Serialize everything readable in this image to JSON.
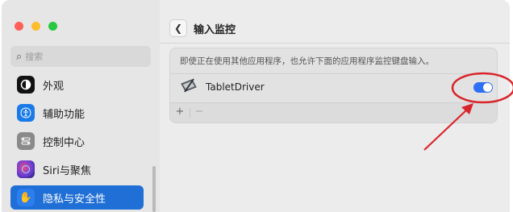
{
  "window": {
    "traffic_lights": [
      "#ff5f57",
      "#febc2e",
      "#28c840"
    ]
  },
  "sidebar": {
    "search_placeholder": "搜索",
    "items": [
      {
        "label": "外观",
        "icon": "appearance-icon",
        "icon_bg": "#111111"
      },
      {
        "label": "辅助功能",
        "icon": "accessibility-icon",
        "icon_bg": "#1a7ae8"
      },
      {
        "label": "控制中心",
        "icon": "control-center-icon",
        "icon_bg": "#8a8a8a"
      },
      {
        "label": "Siri与聚焦",
        "icon": "siri-icon",
        "icon_bg": "#3a2a8f"
      },
      {
        "label": "隐私与安全性",
        "icon": "privacy-hand-icon",
        "icon_bg": "#2a7ef0",
        "active": true
      }
    ]
  },
  "main": {
    "title": "输入监控",
    "description": "即使正在使用其他应用程序，也允许下面的应用程序监控键盘输入。",
    "apps": [
      {
        "name": "TabletDriver",
        "enabled": true
      }
    ],
    "toolbar": {
      "add": "+",
      "remove": "−"
    }
  },
  "colors": {
    "accent": "#1f6fd6",
    "toggle_on": "#2d6ff5",
    "annotation_red": "#d9252a"
  }
}
